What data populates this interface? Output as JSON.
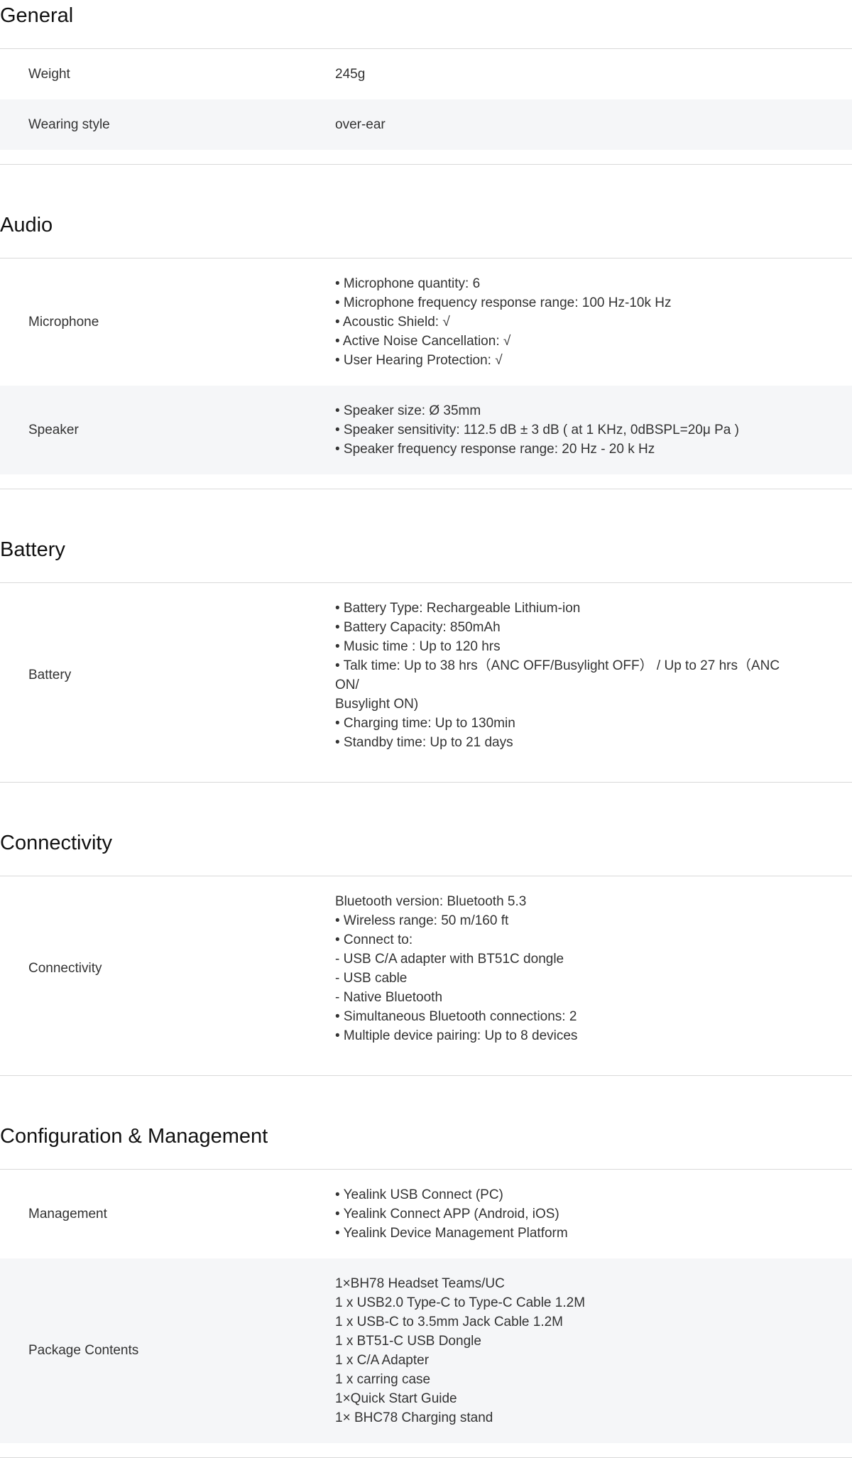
{
  "sections": [
    {
      "title": "General",
      "rows": [
        {
          "label": "Weight",
          "lines": [
            "245g"
          ]
        },
        {
          "label": "Wearing style",
          "lines": [
            "over-ear"
          ]
        }
      ]
    },
    {
      "title": "Audio",
      "rows": [
        {
          "label": "Microphone",
          "lines": [
            "• Microphone quantity: 6",
            "• Microphone frequency response range: 100 Hz-10k Hz",
            "• Acoustic Shield: √",
            "• Active Noise Cancellation: √",
            "• User Hearing Protection: √"
          ]
        },
        {
          "label": "Speaker",
          "lines": [
            "• Speaker size: Ø 35mm",
            "• Speaker sensitivity: 112.5 dB ± 3 dB ( at 1 KHz, 0dBSPL=20μ Pa )",
            "• Speaker frequency response range: 20 Hz - 20 k Hz"
          ]
        }
      ]
    },
    {
      "title": "Battery",
      "rows": [
        {
          "label": "Battery",
          "lines": [
            "• Battery Type: Rechargeable Lithium-ion",
            "• Battery Capacity: 850mAh",
            "• Music time : Up to 120 hrs",
            "• Talk time: Up to 38 hrs（ANC OFF/Busylight OFF） / Up to 27 hrs（ANC ON/",
            "Busylight ON)",
            "• Charging time: Up to 130min",
            "• Standby time: Up to 21 days"
          ]
        }
      ]
    },
    {
      "title": "Connectivity",
      "rows": [
        {
          "label": "Connectivity",
          "lines": [
            "Bluetooth version: Bluetooth 5.3",
            "• Wireless range: 50 m/160 ft",
            "• Connect to:",
            "- USB C/A adapter with BT51C dongle",
            "- USB cable",
            "- Native Bluetooth",
            "• Simultaneous Bluetooth connections: 2",
            "• Multiple device pairing: Up to 8 devices"
          ]
        }
      ]
    },
    {
      "title": "Configuration & Management",
      "rows": [
        {
          "label": "Management",
          "lines": [
            "• Yealink USB Connect (PC)",
            "• Yealink Connect APP (Android, iOS)",
            "• Yealink Device Management Platform"
          ]
        },
        {
          "label": "Package Contents",
          "lines": [
            "1×BH78 Headset Teams/UC",
            "1 x USB2.0 Type-C to Type-C Cable 1.2M",
            "1 x USB-C to 3.5mm Jack Cable 1.2M",
            "1 x BT51-C USB Dongle",
            "1 x C/A Adapter",
            "1 x carring case",
            "1×Quick Start Guide",
            "1× BHC78 Charging stand"
          ]
        }
      ]
    }
  ]
}
